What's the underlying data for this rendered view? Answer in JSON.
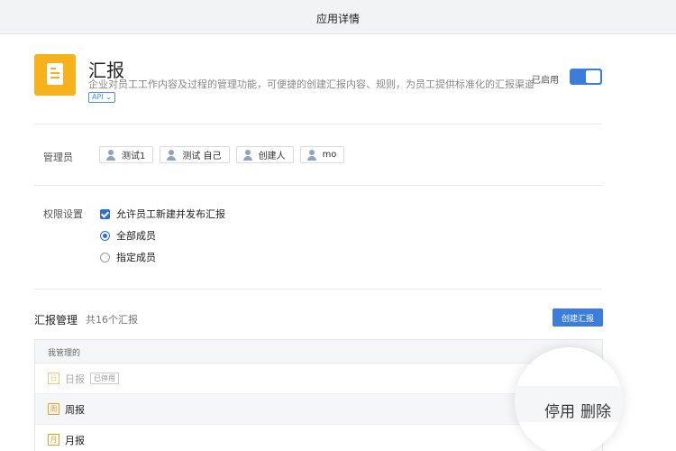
{
  "window": {
    "title": "应用详情"
  },
  "app": {
    "name": "汇报",
    "description": "企业对员工工作内容及过程的管理功能，可便捷的创建汇报内容、规则，为员工提供标准化的汇报渠道",
    "api_tag": "API ⌄",
    "status_label": "已启用",
    "icon": "report-document-icon",
    "accent_color": "#f5b21d"
  },
  "admins": {
    "label": "管理员",
    "items": [
      "测试1",
      "测试 自己",
      "创建人",
      "mo"
    ]
  },
  "permissions": {
    "label": "权限设置",
    "allow_create": {
      "label": "允许员工新建并发布汇报",
      "checked": true
    },
    "scope_all": {
      "label": "全部成员",
      "selected": true
    },
    "scope_specific": {
      "label": "指定成员",
      "selected": false
    }
  },
  "reports": {
    "title": "汇报管理",
    "count": "共16个汇报",
    "create_button": "创建汇报",
    "table_header": "我管理的",
    "rows": [
      {
        "icon_char": "日",
        "name": "日报",
        "badge": "已停用"
      },
      {
        "icon_char": "周",
        "name": "周报"
      },
      {
        "icon_char": "月",
        "name": "月报"
      }
    ]
  },
  "magnifier": {
    "disable_label": "停用",
    "delete_label": "删除"
  },
  "colors": {
    "primary": "#3b7dd8",
    "icon_orange": "#f0a020"
  }
}
